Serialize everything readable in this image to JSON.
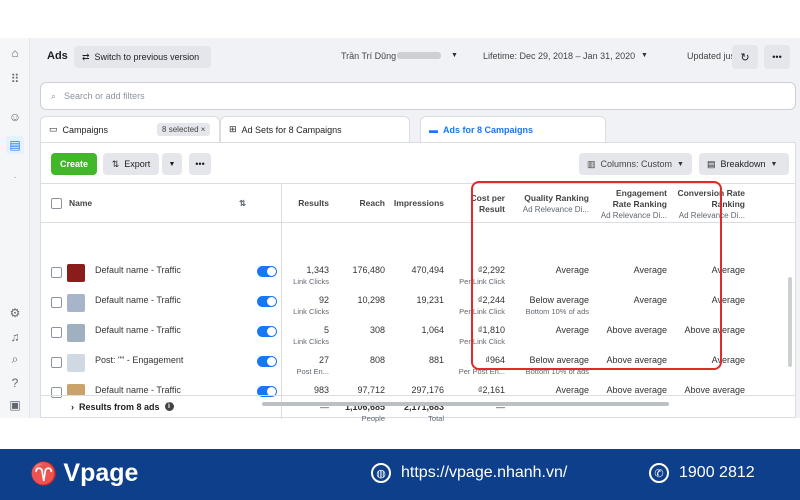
{
  "topbar": {
    "title": "Ads",
    "switch_label": "Switch to previous version",
    "user_name": "Trần Trí Dũng",
    "lifetime": "Lifetime: Dec 29, 2018 – Jan 31, 2020",
    "updated": "Updated just now"
  },
  "filter": {
    "placeholder": "Search or add filters"
  },
  "tabs": [
    {
      "label": "Campaigns",
      "badge": "8 selected"
    },
    {
      "label": "Ad Sets for 8 Campaigns"
    },
    {
      "label": "Ads for 8 Campaigns"
    }
  ],
  "toolbar": {
    "create": "Create",
    "export": "Export",
    "columns": "Columns: Custom",
    "breakdown": "Breakdown"
  },
  "columns": {
    "name": "Name",
    "results": "Results",
    "reach": "Reach",
    "impressions": "Impressions",
    "cost_per_result_1": "Cost per",
    "cost_per_result_2": "Result",
    "quality": "Quality Ranking",
    "engagement_1": "Engagement",
    "engagement_2": "Rate Ranking",
    "conversion_1": "Conversion Rate",
    "conversion_2": "Ranking",
    "relevance_sub": "Ad Relevance Di..."
  },
  "rows": [
    {
      "name": "Default name - Traffic",
      "results": "1,343",
      "results_sub": "Link Clicks",
      "reach": "176,480",
      "impressions": "470,494",
      "cost": "₫2,292",
      "cost_sub": "Per Link Click",
      "quality": "Average",
      "quality_sub": "",
      "engagement": "Average",
      "conversion": "Average"
    },
    {
      "name": "Default name - Traffic",
      "results": "92",
      "results_sub": "Link Clicks",
      "reach": "10,298",
      "impressions": "19,231",
      "cost": "₫2,244",
      "cost_sub": "Per Link Click",
      "quality": "Below average",
      "quality_sub": "Bottom 10% of ads",
      "engagement": "Average",
      "conversion": "Average"
    },
    {
      "name": "Default name - Traffic",
      "results": "5",
      "results_sub": "Link Clicks",
      "reach": "308",
      "impressions": "1,064",
      "cost": "₫1,810",
      "cost_sub": "Per Link Click",
      "quality": "Average",
      "quality_sub": "",
      "engagement": "Above average",
      "conversion": "Above average"
    },
    {
      "name": "Post: \"\" - Engagement",
      "results": "27",
      "results_sub": "Post En...",
      "reach": "808",
      "impressions": "881",
      "cost": "₫964",
      "cost_sub": "Per Post En...",
      "quality": "Below average",
      "quality_sub": "Bottom 10% of ads",
      "engagement": "Above average",
      "conversion": "Average"
    },
    {
      "name": "Default name - Traffic",
      "results": "983",
      "results_sub": "",
      "reach": "97,712",
      "impressions": "297,176",
      "cost": "₫2,161",
      "cost_sub": "",
      "quality": "Average",
      "quality_sub": "",
      "engagement": "Above average",
      "conversion": "Above average"
    }
  ],
  "summary": {
    "label": "Results from 8 ads",
    "results": "—",
    "reach": "1,106,685",
    "reach_sub": "People",
    "impressions": "2,171,683",
    "impressions_sub": "Total",
    "cost": "—"
  },
  "footer": {
    "brand": "Vpage",
    "url": "https://vpage.nhanh.vn/",
    "phone": "1900 2812"
  },
  "colors": {
    "accent": "#1877f2",
    "create": "#42b72a",
    "highlight": "#e12a2a",
    "footer": "#0d3f8a"
  }
}
